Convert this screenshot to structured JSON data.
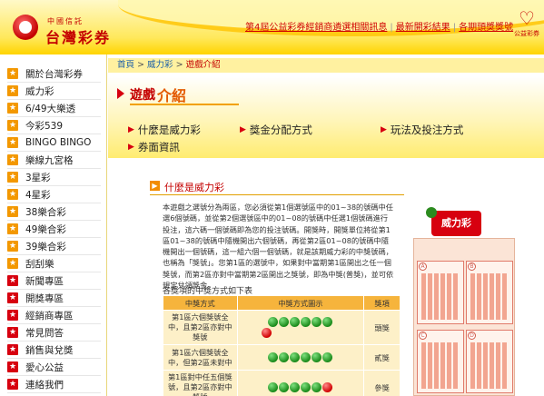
{
  "header": {
    "logo_small": "中國信託",
    "logo_text": "台灣彩券",
    "top_links": [
      "第4屆公益彩券經銷商遴選相關訊息",
      "最新開彩結果",
      "各期頭獎獎號"
    ],
    "badge_caption": "公益彩券"
  },
  "sidebar": {
    "items": [
      {
        "label": "關於台灣彩券",
        "color": "orange"
      },
      {
        "label": "威力彩",
        "color": "orange"
      },
      {
        "label": "6/49大樂透",
        "color": "orange"
      },
      {
        "label": "今彩539",
        "color": "orange"
      },
      {
        "label": "BINGO BINGO",
        "color": "orange"
      },
      {
        "label": "樂線九宮格",
        "color": "orange"
      },
      {
        "label": "3星彩",
        "color": "orange"
      },
      {
        "label": "4星彩",
        "color": "orange"
      },
      {
        "label": "38樂合彩",
        "color": "orange"
      },
      {
        "label": "49樂合彩",
        "color": "orange"
      },
      {
        "label": "39樂合彩",
        "color": "orange"
      },
      {
        "label": "刮刮樂",
        "color": "orange"
      },
      {
        "label": "新聞專區",
        "color": "red"
      },
      {
        "label": "開獎專區",
        "color": "red"
      },
      {
        "label": "經銷商專區",
        "color": "red"
      },
      {
        "label": "常見問答",
        "color": "red"
      },
      {
        "label": "銷售與兌獎",
        "color": "red"
      },
      {
        "label": "愛心公益",
        "color": "red"
      },
      {
        "label": "連絡我們",
        "color": "red"
      },
      {
        "label": "English",
        "color": "red"
      }
    ]
  },
  "breadcrumb": {
    "home": "首頁",
    "sep": ">",
    "section": "威力彩",
    "current": "遊戲介紹"
  },
  "page": {
    "title_part1": "遊戲",
    "title_part2": "介紹",
    "links": [
      "什麼是威力彩",
      "獎金分配方式",
      "玩法及投注方式",
      "券面資訊"
    ],
    "section_title": "什麼是威力彩",
    "paragraph": "本遊戲之選號分為兩區，您必須從第1個選號區中的01~38的號碼中任選6個號碼，並從第2個選號區中的01~08的號碼中任選1個號碼進行投注，這六碼一個號碼即為您的投注號碼。開獎時，開獎單位將從第1區01~38的號碼中隨機開出六個號碼，再從第2區01~08的號碼中隨機開出一個號碼，這一組六個一個號碼，就是該期威力彩的中獎號碼，也稱為「獎號」。您第1區的選號中，如果對中當期第1區開出之任一個獎號，而第2區亦對中當期第2區開出之獎號，即為中獎(普獎)，並可依規定兌領獎金。",
    "table_caption": "各獎項的中獎方式如下表",
    "table_headers": [
      "中獎方式",
      "中獎方式圖示",
      "獎項"
    ],
    "rows": [
      {
        "desc": "第1區六個獎號全中，且第2區亦對中獎號",
        "prize": "頭獎"
      },
      {
        "desc": "第1區六個獎號全中，但第2區未對中",
        "prize": "貳獎"
      },
      {
        "desc": "第1區對中任五個獎號，且第2區亦對中獎號",
        "prize": "參獎"
      }
    ]
  },
  "ticket": {
    "brand": "威力彩",
    "panels": [
      "A",
      "B",
      "C",
      "D"
    ]
  }
}
